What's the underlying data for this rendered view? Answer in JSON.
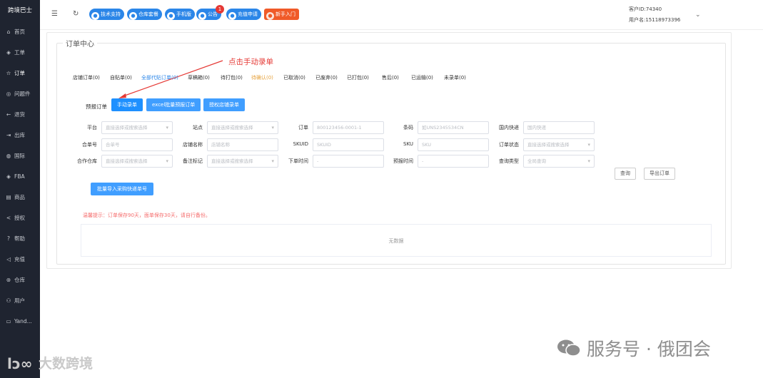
{
  "sidebar": {
    "brand": "跨境巴士",
    "items": [
      {
        "icon": "home-icon",
        "glyph": "⌂",
        "label": "首页"
      },
      {
        "icon": "ticket-icon",
        "glyph": "◈",
        "label": "工单"
      },
      {
        "icon": "star-icon",
        "glyph": "☆",
        "label": "订单"
      },
      {
        "icon": "problem-icon",
        "glyph": "◎",
        "label": "问题件"
      },
      {
        "icon": "return-icon",
        "glyph": "←",
        "label": "退货"
      },
      {
        "icon": "outbound-icon",
        "glyph": "⇥",
        "label": "出库"
      },
      {
        "icon": "globe-icon",
        "glyph": "◍",
        "label": "国际"
      },
      {
        "icon": "fba-icon",
        "glyph": "◈",
        "label": "FBA"
      },
      {
        "icon": "goods-icon",
        "glyph": "▤",
        "label": "商品"
      },
      {
        "icon": "share-icon",
        "glyph": "<",
        "label": "授权"
      },
      {
        "icon": "help-icon",
        "glyph": "?",
        "label": "帮助"
      },
      {
        "icon": "send-icon",
        "glyph": "◁",
        "label": "充值"
      },
      {
        "icon": "warehouse-icon",
        "glyph": "⊛",
        "label": "仓库"
      },
      {
        "icon": "user-icon",
        "glyph": "⚇",
        "label": "用户"
      },
      {
        "icon": "window-icon",
        "glyph": "▭",
        "label": "Yand..."
      }
    ]
  },
  "header": {
    "pills": [
      {
        "icon": "support-icon",
        "label": "技术支持"
      },
      {
        "icon": "warehouse-guide-icon",
        "label": "仓库套餐"
      },
      {
        "icon": "phone-icon",
        "label": "手机版"
      },
      {
        "icon": "notice-icon",
        "label": "公告",
        "badge": "1"
      },
      {
        "icon": "recharge-icon",
        "label": "充值申请"
      },
      {
        "icon": "newbie-icon",
        "label": "新手入门"
      }
    ],
    "customer_id": "客户ID:74340",
    "username": "用户名:15118973396"
  },
  "page": {
    "title": "订单中心",
    "annotation": "点击手动录单",
    "tabs": [
      "店铺订单(0)",
      "自贴单(0)",
      "全部代贴订单(0)",
      "草稿箱(0)",
      "待打包(0)",
      "待确认(0)",
      "已取消(0)",
      "已废弃(0)",
      "已打包(0)",
      "售后(0)",
      "已运输(0)",
      "未录单(0)"
    ],
    "pre_order_label": "预报订单",
    "buttons": {
      "manual": "手动录单",
      "excel": "excel批量预报订单",
      "shop": "授权店铺录单"
    },
    "filters": {
      "platform": {
        "label": "平台",
        "placeholder": "直接选择或搜索选择"
      },
      "site": {
        "label": "站点",
        "placeholder": "直接选择或搜索选择"
      },
      "order": {
        "label": "订单",
        "placeholder": "800123456-0001-1"
      },
      "barcode": {
        "label": "条码",
        "placeholder": "如UNS2345534CN"
      },
      "domestic": {
        "label": "国内快递",
        "placeholder": "国内快递"
      },
      "merge": {
        "label": "合单号",
        "placeholder": "合单号"
      },
      "shop_name": {
        "label": "店铺名称",
        "placeholder": "店铺名称"
      },
      "skuid": {
        "label": "SKUID",
        "placeholder": "SKUID"
      },
      "sku": {
        "label": "SKU",
        "placeholder": "SKU"
      },
      "status": {
        "label": "订单状态",
        "placeholder": "直接选择或搜索选择"
      },
      "partner": {
        "label": "合作仓库",
        "placeholder": "直接选择或搜索选择"
      },
      "remark": {
        "label": "备注标记",
        "placeholder": "直接选择或搜索选择"
      },
      "order_time": {
        "label": "下单时间",
        "placeholder": "-"
      },
      "forecast_time": {
        "label": "预报时间",
        "placeholder": "-"
      },
      "query_type": {
        "label": "查询类型",
        "placeholder": "全局查询"
      }
    },
    "search_btn": "查询",
    "export_btn": "导出订单",
    "import_btn": "批量导入采购快递单号",
    "tip": "温馨提示：订单保存90天，面单保存30天，请自行备份。",
    "empty": "无数据"
  },
  "watermark": {
    "text": "服务号 · 俄团会",
    "text2": "大数跨境"
  }
}
